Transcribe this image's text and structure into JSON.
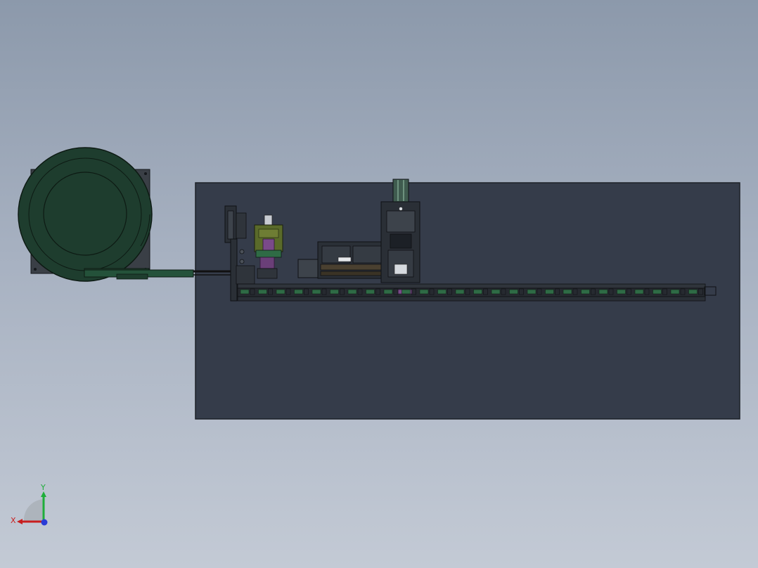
{
  "viewport": {
    "background_top": "#8c99ab",
    "background_bottom": "#c3cad5",
    "model": {
      "base_plate_color": "#353c4a",
      "bowl_color": "#1e3d2e",
      "frame_color": "#2a2f36",
      "rail_accent_color": "#2f6b45",
      "purple_part_color": "#7a4a8a",
      "olive_part_color": "#5a6a2a"
    }
  },
  "triad": {
    "x_label": "X",
    "y_label": "Y",
    "x_color": "#c81e1e",
    "y_color": "#1fae3a",
    "z_color": "#2a3cd6"
  }
}
